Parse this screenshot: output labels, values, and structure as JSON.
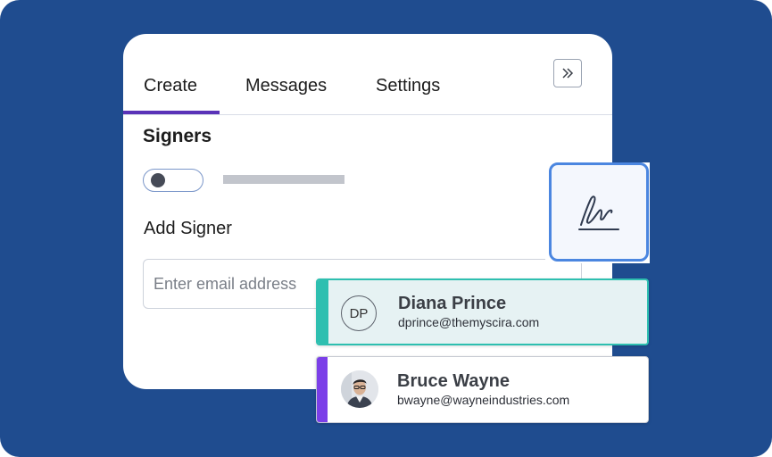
{
  "tabs": [
    {
      "label": "Create",
      "active": true
    },
    {
      "label": "Messages",
      "active": false
    },
    {
      "label": "Settings",
      "active": false
    }
  ],
  "panel": {
    "heading": "Signers",
    "add_signer_label": "Add Signer",
    "email_placeholder": "Enter email address",
    "email_value": "",
    "toggle_on": false,
    "expand_icon": "double-chevron-right-icon"
  },
  "signature_icon": "signature-icon",
  "signers": [
    {
      "name": "Diana Prince",
      "email": "dprince@themyscira.com",
      "initials": "DP",
      "accent": "#2ebfb0"
    },
    {
      "name": "Bruce Wayne",
      "email": "bwayne@wayneindustries.com",
      "avatar": "photo",
      "accent": "#7b3fe8"
    }
  ],
  "colors": {
    "background": "#1f4c8f",
    "active_tab": "#5a33b8",
    "signature_border": "#4b86e0"
  }
}
